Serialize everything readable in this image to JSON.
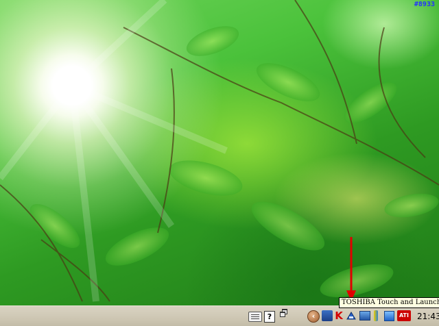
{
  "watermark": "#8933",
  "tooltip": "TOSHIBA Touch and Launch",
  "taskbar": {
    "clock": "21:43",
    "help_label": "?",
    "expand_label": "‹",
    "k_label": "K",
    "ati_label": "ATI"
  },
  "annotation": {
    "color": "#e00000",
    "target": "TOSHIBA Touch and Launch tray icon"
  },
  "icons": {
    "keyboard": "keyboard-icon",
    "help": "help-icon",
    "restore": "restore-icon",
    "network": "network-icon",
    "toshiba": "toshiba-touch-launch-icon",
    "display": "display-icon",
    "pen": "pen-icon",
    "bluetooth": "bluetooth-icon",
    "ati": "ati-icon"
  }
}
